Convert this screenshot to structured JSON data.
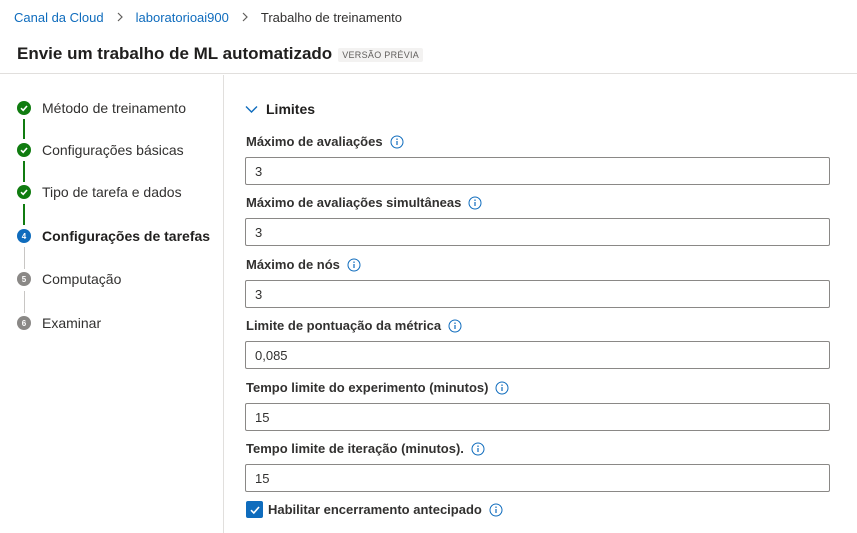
{
  "breadcrumb": {
    "items": [
      "Canal da Cloud",
      "laboratorioai900"
    ],
    "current": "Trabalho de treinamento"
  },
  "header": {
    "title": "Envie um trabalho de ML automatizado",
    "badge": "VERSÃO PRÉVIA"
  },
  "steps": [
    {
      "label": "Método de treinamento",
      "status": "done"
    },
    {
      "label": "Configurações básicas",
      "status": "done"
    },
    {
      "label": "Tipo de tarefa e dados",
      "status": "done"
    },
    {
      "label": "Configurações de tarefas",
      "status": "active",
      "number": "4"
    },
    {
      "label": "Computação",
      "status": "pending",
      "number": "5"
    },
    {
      "label": "Examinar",
      "status": "pending",
      "number": "6"
    }
  ],
  "section": {
    "title": "Limites",
    "fields": [
      {
        "label": "Máximo de avaliações",
        "value": "3"
      },
      {
        "label": "Máximo de avaliações simultâneas",
        "value": "3"
      },
      {
        "label": "Máximo de nós",
        "value": "3"
      },
      {
        "label": "Limite de pontuação da métrica",
        "value": "0,085"
      },
      {
        "label": "Tempo limite do experimento (minutos)",
        "value": "15"
      },
      {
        "label": "Tempo limite de iteração (minutos).",
        "value": "15"
      }
    ],
    "checkbox": {
      "label": "Habilitar encerramento antecipado",
      "checked": true
    }
  },
  "colors": {
    "accent": "#0f6cbd",
    "success": "#107c10",
    "pending": "#8a8886"
  }
}
